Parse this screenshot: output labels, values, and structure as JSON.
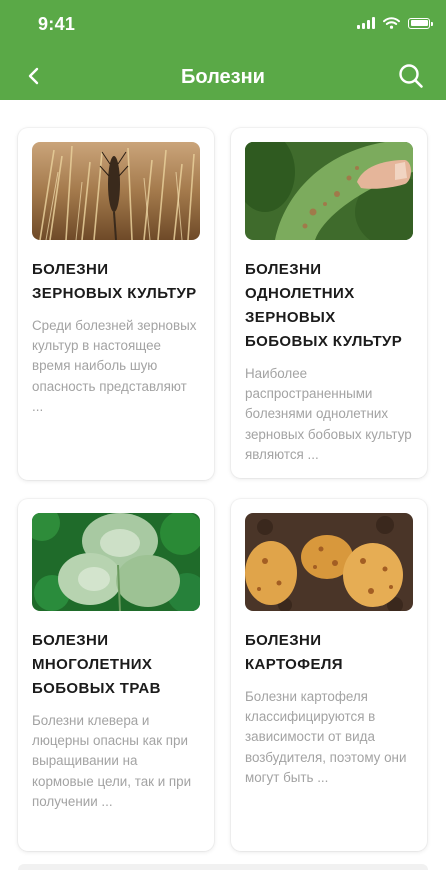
{
  "status_bar": {
    "time": "9:41"
  },
  "header": {
    "title": "Болезни"
  },
  "colors": {
    "accent": "#5aa947",
    "card_title": "#1b1b1b",
    "card_desc": "#a3a3a3"
  },
  "icons": {
    "back": "chevron-left-icon",
    "search": "search-icon"
  },
  "cards": [
    {
      "title": "Болезни зерновых культур",
      "desc": "Среди болезней зерновых культур в настоящее время наиболь шую опасность представляют ..."
    },
    {
      "title": "Болезни однолетних зерновых бобовых культур",
      "desc": "Наиболее распространенными болезнями однолетних зерновых бобовых культур являются ..."
    },
    {
      "title": "Болезни многолетних бобовых трав",
      "desc": "Болезни клевера и люцерны опасны как при выращивании на кормовые цели, так и при получении ..."
    },
    {
      "title": "Болезни картофеля",
      "desc": "Болезни картофеля классифицируются в зависимости от вида возбудителя, поэтому они могут быть ..."
    }
  ]
}
